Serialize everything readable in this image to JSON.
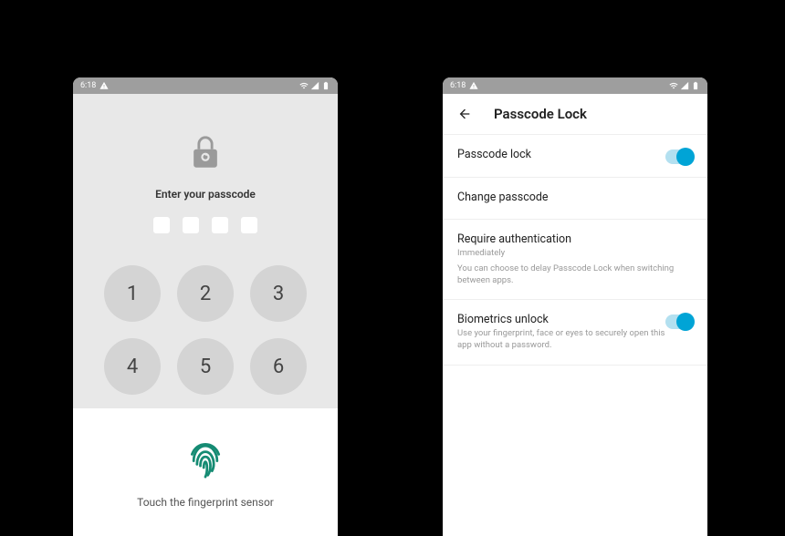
{
  "status": {
    "time": "6:18"
  },
  "passcode": {
    "prompt": "Enter your passcode",
    "keys": [
      "1",
      "2",
      "3",
      "4",
      "5",
      "6"
    ]
  },
  "fingerprint": {
    "prompt": "Touch the fingerprint sensor"
  },
  "settings": {
    "title": "Passcode Lock",
    "items": {
      "lock": {
        "label": "Passcode lock"
      },
      "change": {
        "label": "Change passcode"
      },
      "require": {
        "label": "Require authentication",
        "subtitle": "Immediately",
        "desc": "You can choose to delay Passcode Lock when switching between apps."
      },
      "biometrics": {
        "label": "Biometrics unlock",
        "desc": "Use your fingerprint, face or eyes to securely open this app without a password."
      }
    }
  }
}
